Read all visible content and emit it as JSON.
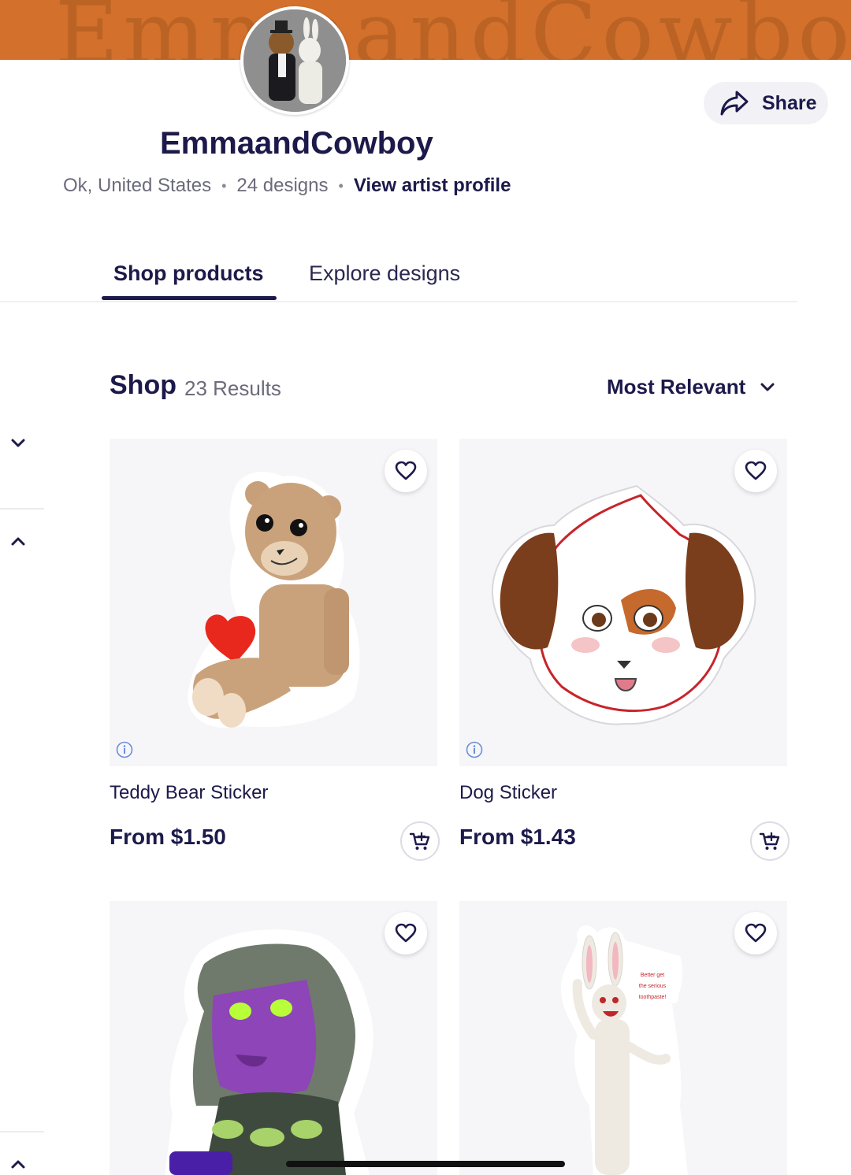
{
  "banner": {
    "scribble_text": "EmmaandCowboy"
  },
  "artist": {
    "name": "EmmaandCowboy",
    "location": "Ok, United States",
    "designs": "24 designs",
    "profile_link": "View artist profile"
  },
  "share": {
    "label": "Share"
  },
  "tabs": [
    {
      "label": "Shop products",
      "active": true
    },
    {
      "label": "Explore designs",
      "active": false
    }
  ],
  "shop": {
    "title": "Shop",
    "results": "23 Results",
    "sort_label": "Most Relevant"
  },
  "products": [
    {
      "title": "Teddy Bear Sticker",
      "price": "From $1.50"
    },
    {
      "title": "Dog Sticker",
      "price": "From $1.43"
    },
    {
      "title": "",
      "price": ""
    },
    {
      "title": "",
      "price": ""
    }
  ],
  "sticker_text": [
    "Better get",
    "the serious",
    "toothpaste!"
  ],
  "colors": {
    "banner": "#d2702c",
    "brand_text": "#1c1a4a",
    "muted_text": "#6b6b7b",
    "card_bg": "#f6f6f9"
  }
}
